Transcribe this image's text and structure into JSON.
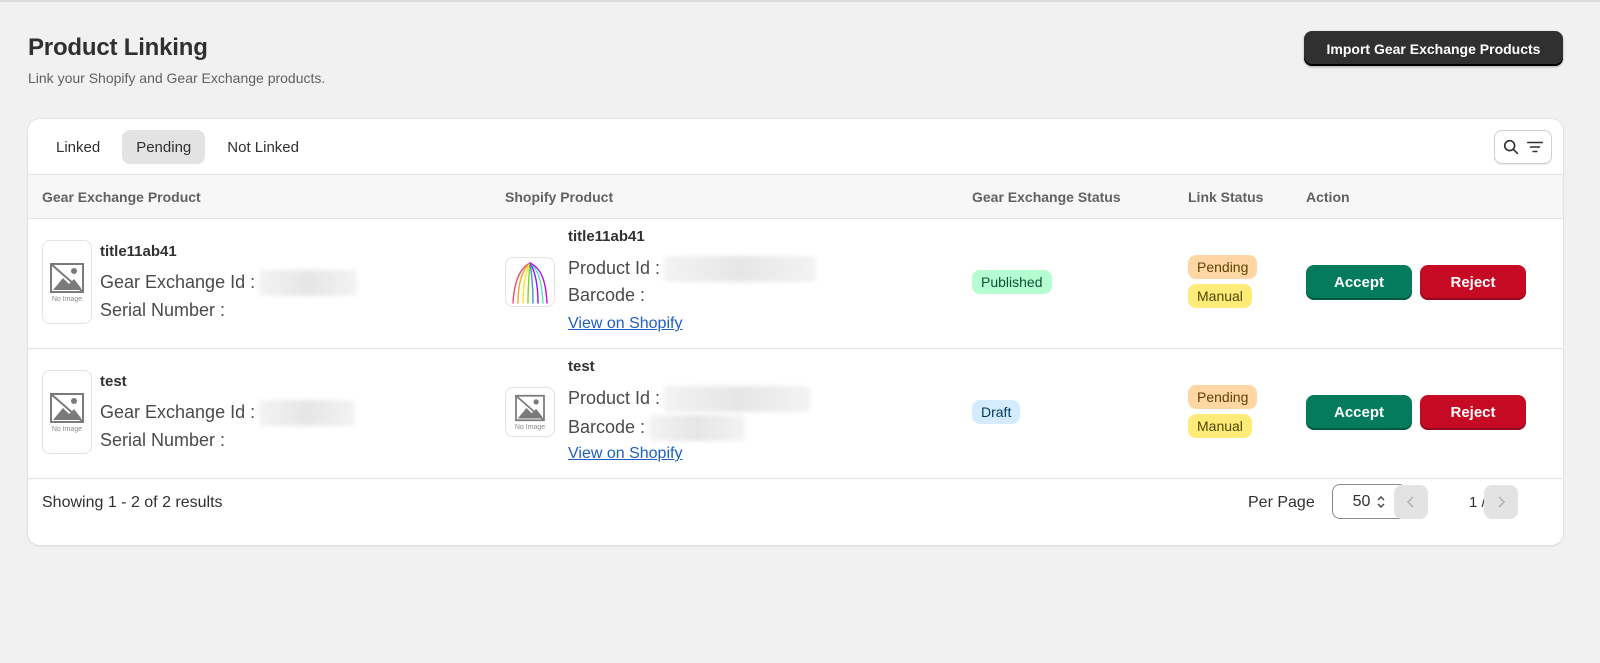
{
  "header": {
    "title": "Product Linking",
    "subtitle": "Link your Shopify and Gear Exchange products.",
    "import_button": "Import Gear Exchange Products"
  },
  "tabs": [
    {
      "label": "Linked",
      "active": false
    },
    {
      "label": "Pending",
      "active": true
    },
    {
      "label": "Not Linked",
      "active": false
    }
  ],
  "icons": {
    "search": "search-icon",
    "filter": "filter-icon"
  },
  "columns": [
    "Gear Exchange Product",
    "Shopify Product",
    "Gear Exchange Status",
    "Link Status",
    "Action"
  ],
  "rows": [
    {
      "ge_title": "title11ab41",
      "ge_id_label": "Gear Exchange Id :",
      "serial_label": "Serial Number :",
      "no_image": "No Image",
      "shopify_title": "title11ab41",
      "product_id_label": "Product Id :",
      "barcode_label": "Barcode :",
      "view_link": "View on Shopify",
      "ge_status": "Published",
      "link_status": [
        "Pending",
        "Manual"
      ],
      "accept": "Accept",
      "reject": "Reject"
    },
    {
      "ge_title": "test",
      "ge_id_label": "Gear Exchange Id :",
      "serial_label": "Serial Number :",
      "no_image": "No Image",
      "shopify_title": "test",
      "product_id_label": "Product Id :",
      "barcode_label": "Barcode :",
      "view_link": "View on Shopify",
      "ge_status": "Draft",
      "link_status": [
        "Pending",
        "Manual"
      ],
      "accept": "Accept",
      "reject": "Reject"
    }
  ],
  "footer": {
    "showing": "Showing 1 - 2 of 2 results",
    "per_page_label": "Per Page",
    "per_page_value": "50",
    "page": "1 / 1"
  },
  "colors": {
    "published_bg": "#b4fed2",
    "published_fg": "#0c5132",
    "draft_bg": "#d5ebff",
    "draft_fg": "#003a5a",
    "pending_bg": "#ffd6a4",
    "pending_fg": "#5e4200",
    "manual_bg": "#ffeb78",
    "manual_fg": "#4f4700",
    "accept": "#047b5d",
    "reject": "#c70a24"
  }
}
